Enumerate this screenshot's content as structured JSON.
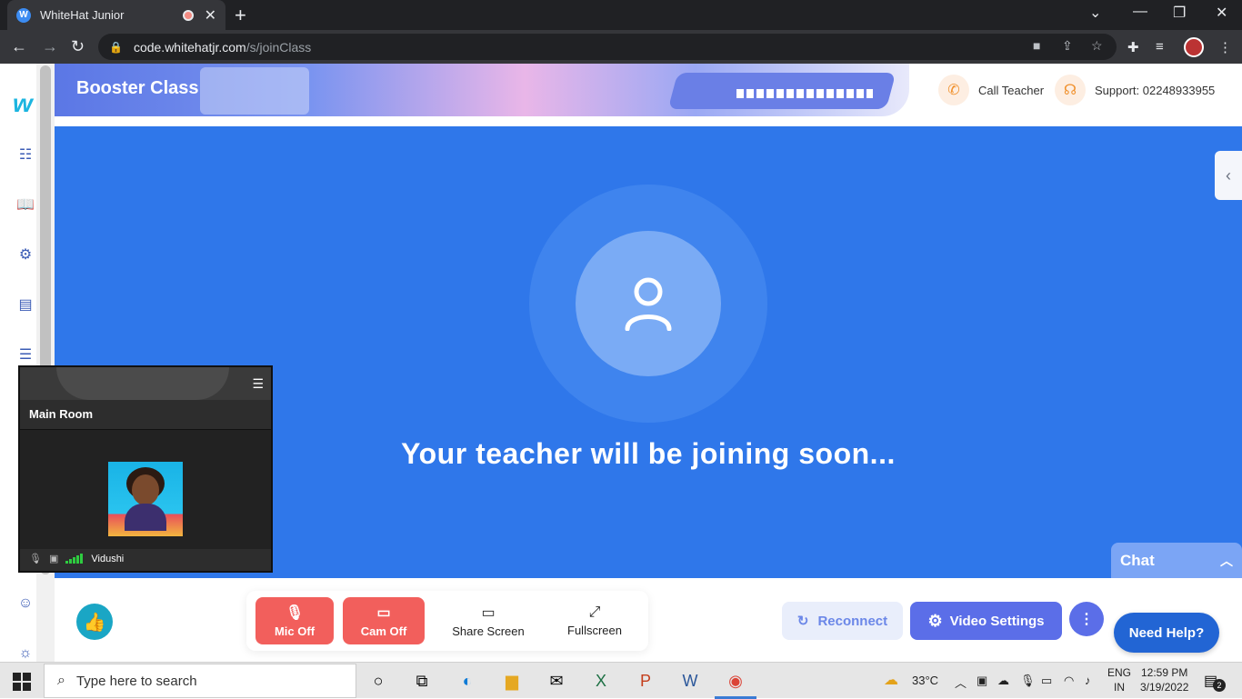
{
  "browser": {
    "tab_title": "WhiteHat Junior",
    "url_host": "code.whitehatjr.com",
    "url_path": "/s/joinClass"
  },
  "header": {
    "banner_title": "Booster Class",
    "call_teacher": "Call Teacher",
    "support": "Support: 02248933955"
  },
  "stage": {
    "waiting_text": "Your teacher will be joining soon..."
  },
  "main_room": {
    "title": "Main Room",
    "participant_name": "Vidushi"
  },
  "controls": {
    "mic_label": "Mic Off",
    "cam_label": "Cam Off",
    "share_label": "Share Screen",
    "fullscreen_label": "Fullscreen",
    "reconnect_label": "Reconnect",
    "video_settings_label": "Video Settings",
    "need_help_label": "Need Help?"
  },
  "chat": {
    "label": "Chat"
  },
  "taskbar": {
    "search_placeholder": "Type here to search",
    "temperature": "33°C",
    "language": "ENG",
    "region": "IN",
    "time": "12:59 PM",
    "date": "3/19/2022",
    "notification_count": "2"
  },
  "colors": {
    "stage_blue": "#2f77ea",
    "mic_cam_red": "#f25f5c",
    "accent_purple": "#5b6ee8"
  }
}
